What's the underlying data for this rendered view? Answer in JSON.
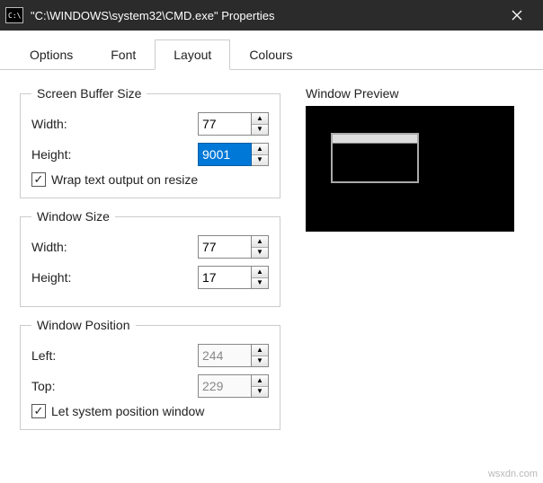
{
  "window": {
    "title": "\"C:\\WINDOWS\\system32\\CMD.exe\" Properties"
  },
  "tabs": {
    "options": "Options",
    "font": "Font",
    "layout": "Layout",
    "colours": "Colours"
  },
  "groups": {
    "screenBuffer": {
      "legend": "Screen Buffer Size",
      "widthLabel": "Width:",
      "widthValue": "77",
      "heightLabel": "Height:",
      "heightValue": "9001",
      "wrapLabel": "Wrap text output on resize",
      "wrapChecked": true
    },
    "windowSize": {
      "legend": "Window Size",
      "widthLabel": "Width:",
      "widthValue": "77",
      "heightLabel": "Height:",
      "heightValue": "17"
    },
    "windowPosition": {
      "legend": "Window Position",
      "leftLabel": "Left:",
      "leftValue": "244",
      "topLabel": "Top:",
      "topValue": "229",
      "sysPosLabel": "Let system position window",
      "sysPosChecked": true
    }
  },
  "preview": {
    "label": "Window Preview"
  },
  "watermark": "wsxdn.com"
}
